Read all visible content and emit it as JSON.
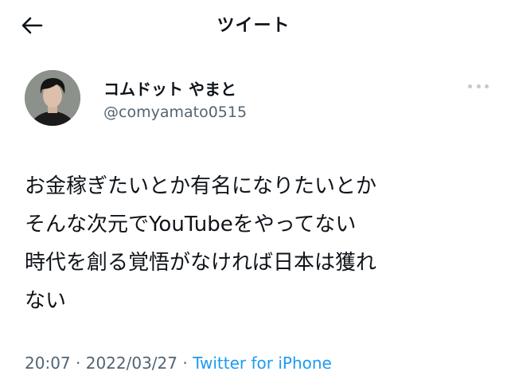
{
  "header": {
    "title": "ツイート",
    "back_icon": "arrow-left-icon"
  },
  "tweet": {
    "author": {
      "display_name": "コムドット やまと",
      "handle": "@comyamato0515"
    },
    "more_icon": "more-dots-icon",
    "text": "お金稼ぎたいとか有名になりたいとか\nそんな次元でYouTubeをやってない\n時代を創る覚悟がなければ日本は獲れ\nない",
    "time": "20:07",
    "separator": " · ",
    "date": "2022/03/27",
    "source": "Twitter for iPhone"
  },
  "colors": {
    "text": "#0f1419",
    "secondary": "#536471",
    "link": "#1d9bf0"
  }
}
